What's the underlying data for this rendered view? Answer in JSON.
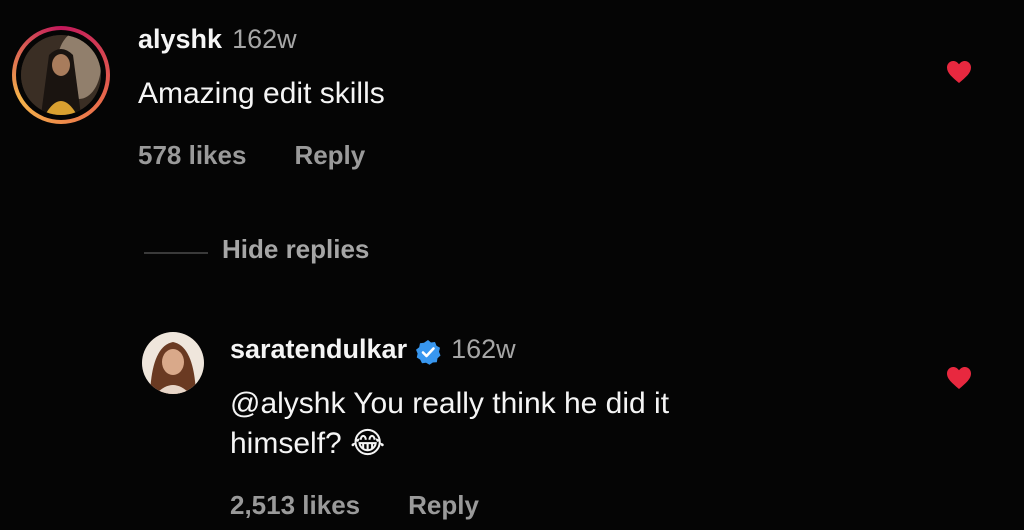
{
  "comment": {
    "username": "alyshk",
    "time": "162w",
    "text": "Amazing edit skills",
    "likes": "578 likes",
    "reply_label": "Reply"
  },
  "hide_replies": "Hide replies",
  "reply": {
    "username": "saratendulkar",
    "time": "162w",
    "text_line1": "@alyshk You really think he did it",
    "text_line2": "himself?",
    "emoji": "😂",
    "likes": "2,513 likes",
    "reply_label": "Reply"
  },
  "colors": {
    "heart": "#e8283f",
    "verified": "#3897f0",
    "background": "#050505"
  }
}
